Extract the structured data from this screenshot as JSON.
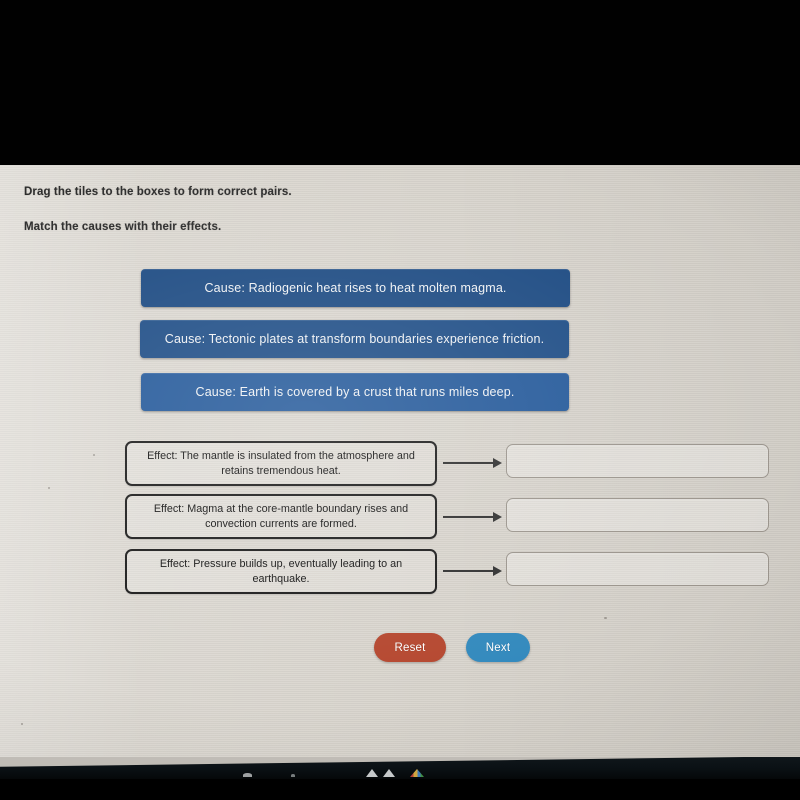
{
  "activity": {
    "instruction_primary": "Drag the tiles to the boxes to form correct pairs.",
    "instruction_secondary": "Match the causes with their effects."
  },
  "tiles": [
    {
      "label": "Cause: Radiogenic heat rises to heat molten magma.",
      "color": "#1c4a82"
    },
    {
      "label": "Cause: Tectonic plates at transform boundaries experience friction.",
      "color": "#1e4d86"
    },
    {
      "label": "Cause: Earth is covered by a crust that runs miles deep.",
      "color": "#24599a"
    }
  ],
  "effects": [
    {
      "label": "Effect: The mantle is insulated from the atmosphere and retains tremendous heat."
    },
    {
      "label": "Effect: Magma at the core-mantle boundary rises and convection currents are formed."
    },
    {
      "label": "Effect: Pressure builds up, eventually leading to an earthquake."
    }
  ],
  "dropzones": [
    {
      "value": ""
    },
    {
      "value": ""
    },
    {
      "value": ""
    }
  ],
  "buttons": {
    "reset_label": "Reset",
    "reset_color": "#b5472f",
    "next_label": "Next",
    "next_color": "#3289bd"
  },
  "taskbar": {
    "icons": [
      "window-icon",
      "dot-icon",
      "triangle-icon",
      "triangle-icon",
      "chrome-icon"
    ]
  },
  "theme": {
    "screen_background": "#d8d4cc",
    "letterbox": "#000000",
    "effect_border": "#1b1b1b",
    "dropzone_border": "#9a948c"
  }
}
